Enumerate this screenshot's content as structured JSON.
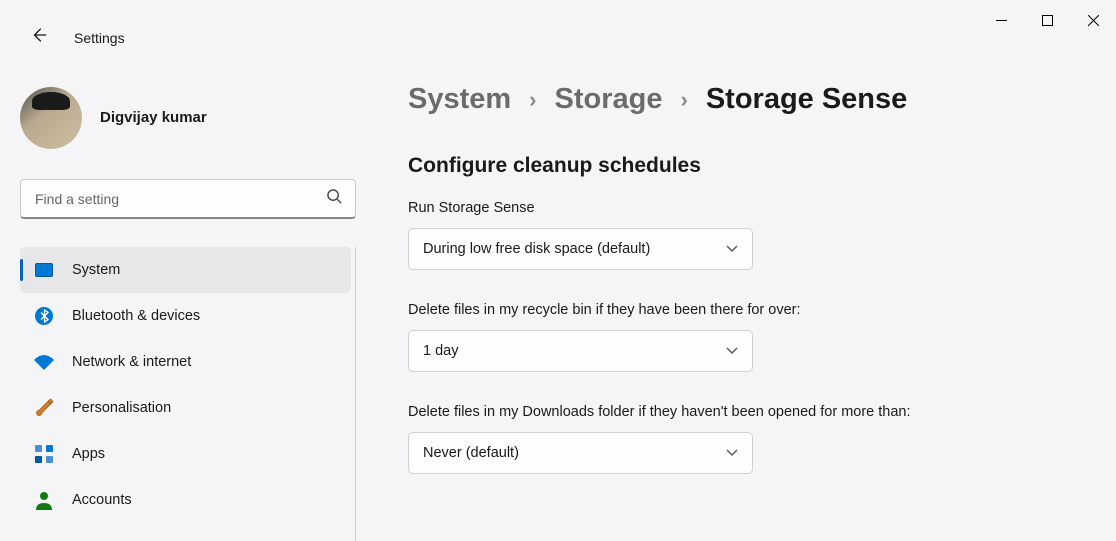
{
  "header": {
    "app_title": "Settings"
  },
  "profile": {
    "name": "Digvijay kumar",
    "sub": " "
  },
  "search": {
    "placeholder": "Find a setting"
  },
  "sidebar": {
    "items": [
      {
        "label": "System"
      },
      {
        "label": "Bluetooth & devices"
      },
      {
        "label": "Network & internet"
      },
      {
        "label": "Personalisation"
      },
      {
        "label": "Apps"
      },
      {
        "label": "Accounts"
      }
    ]
  },
  "breadcrumb": {
    "crumb1": "System",
    "crumb2": "Storage",
    "current": "Storage Sense",
    "sep": "›"
  },
  "main": {
    "section_title": "Configure cleanup schedules",
    "run_label": "Run Storage Sense",
    "run_value": "During low free disk space (default)",
    "recycle_label": "Delete files in my recycle bin if they have been there for over:",
    "recycle_value": "1 day",
    "downloads_label": "Delete files in my Downloads folder if they haven't been opened for more than:",
    "downloads_value": "Never (default)"
  }
}
